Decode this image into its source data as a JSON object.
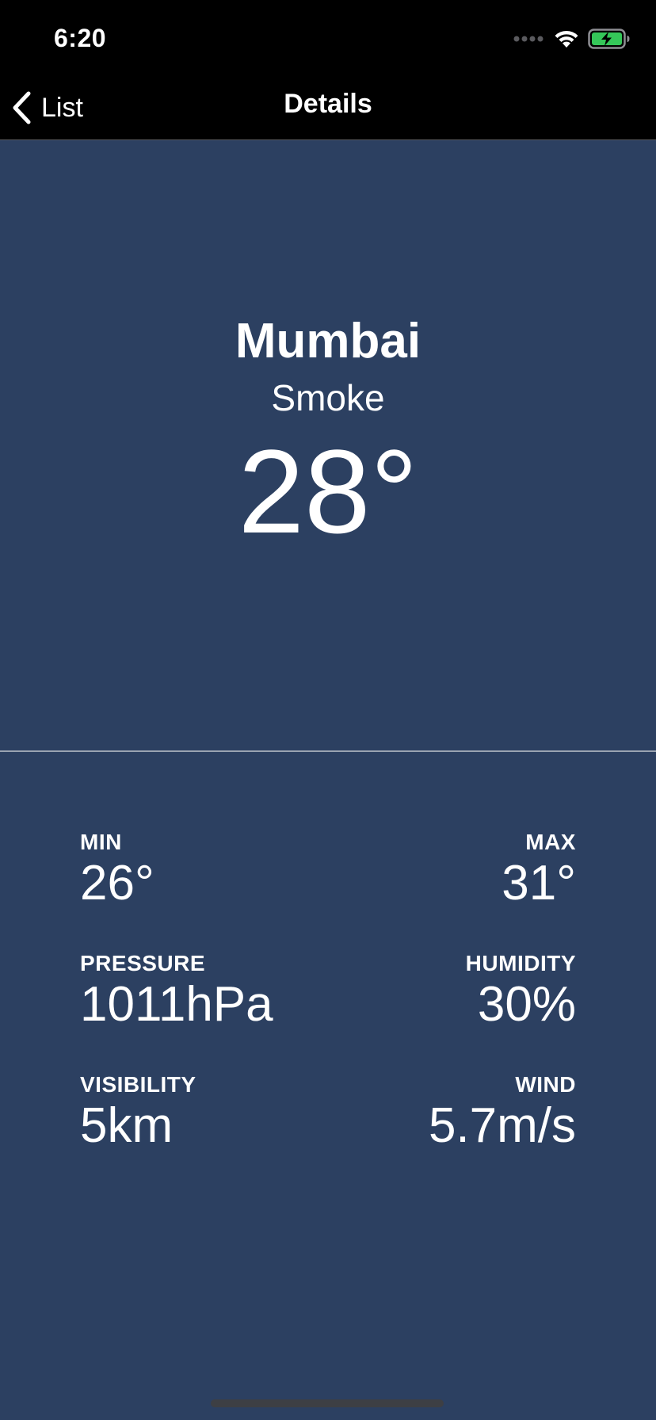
{
  "status_bar": {
    "time": "6:20",
    "icons": [
      "signal-dots-icon",
      "wifi-icon",
      "battery-charging-icon"
    ],
    "battery_color": "#35c759"
  },
  "nav": {
    "back_label": "List",
    "title": "Details"
  },
  "weather": {
    "city": "Mumbai",
    "condition": "Smoke",
    "temperature": "28°"
  },
  "stats": {
    "min": {
      "label": "MIN",
      "value": "26°"
    },
    "max": {
      "label": "MAX",
      "value": "31°"
    },
    "pressure": {
      "label": "PRESSURE",
      "value": "1011hPa"
    },
    "humidity": {
      "label": "HUMIDITY",
      "value": "30%"
    },
    "visibility": {
      "label": "VISIBILITY",
      "value": "5km"
    },
    "wind": {
      "label": "WIND",
      "value": "5.7m/s"
    }
  },
  "colors": {
    "background": "#2c4061",
    "bar": "#000000",
    "text": "#ffffff"
  }
}
